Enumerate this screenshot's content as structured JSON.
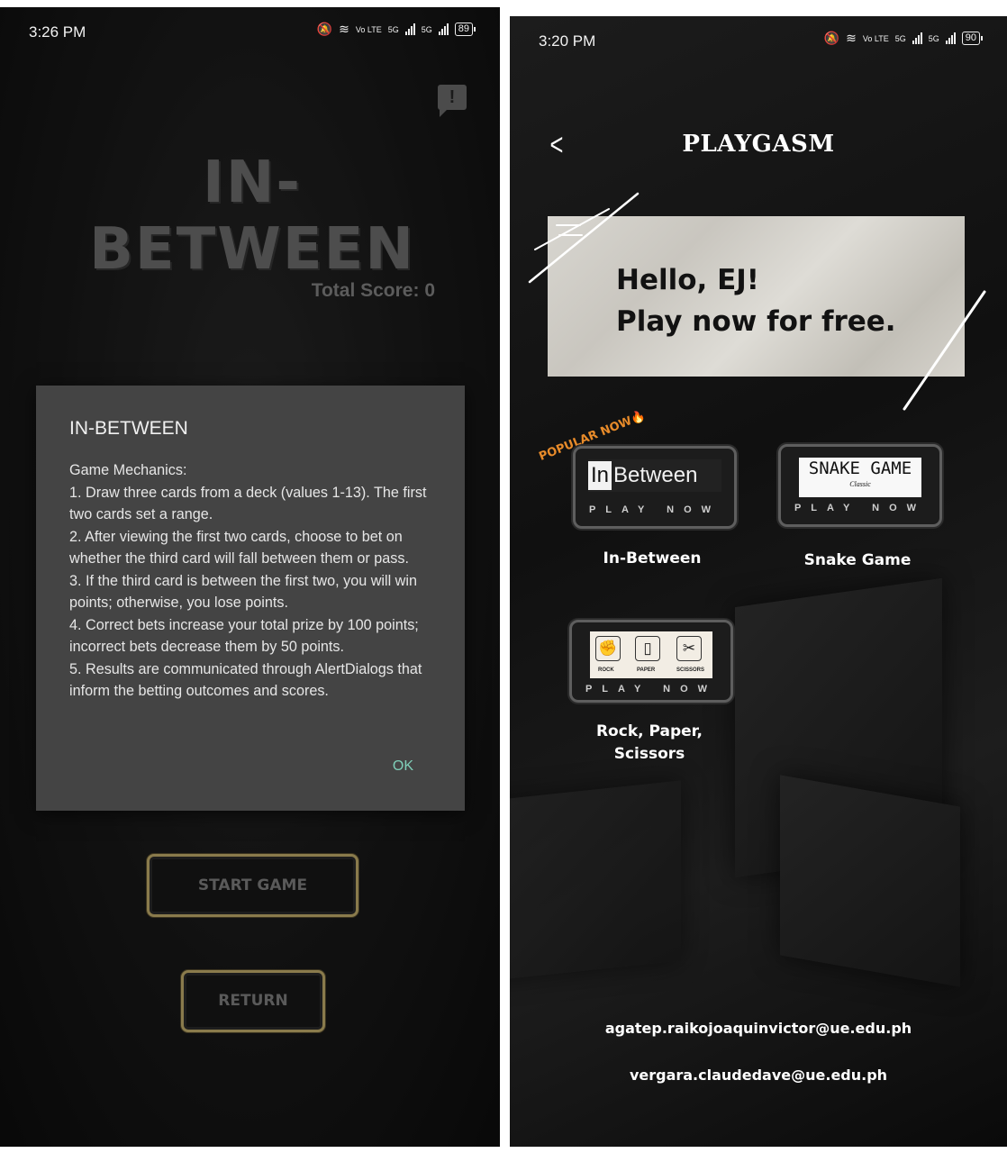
{
  "left_screen": {
    "status": {
      "time": "3:26 PM",
      "network_labels": [
        "Vo LTE",
        "5G",
        "5G"
      ],
      "battery": "89"
    },
    "game_title": "IN-BETWEEN",
    "total_score": "Total Score: 0",
    "dialog": {
      "title": "IN-BETWEEN",
      "heading": "Game Mechanics:",
      "rules": [
        "1. Draw three cards from a deck (values 1-13). The first two cards set a range.",
        "2. After viewing the first two cards, choose to bet on whether the third card will fall between them or pass.",
        "3. If the third card is between the first two, you will win points; otherwise, you lose points.",
        "4. Correct bets increase your total prize by 100 points; incorrect bets decrease them by 50 points.",
        "5. Results are communicated through AlertDialogs that inform the betting outcomes and scores."
      ],
      "ok_label": "OK"
    },
    "start_label": "START GAME",
    "return_label": "RETURN",
    "feedback_icon": "feedback-icon"
  },
  "right_screen": {
    "status": {
      "time": "3:20 PM",
      "network_labels": [
        "Vo LTE",
        "5G",
        "5G"
      ],
      "battery": "90"
    },
    "back_icon": "chevron-left-icon",
    "app_title": "PLAYGASM",
    "banner": {
      "line1": "Hello, EJ!",
      "line2": "Play now for free."
    },
    "popular_badge": "POPULAR NOW🔥",
    "games": [
      {
        "label": "In-Between",
        "logo_box": "In",
        "logo_rest": "Between",
        "play": "PLAY NOW"
      },
      {
        "label": "Snake Game",
        "logo_title": "SNAKE GAME",
        "logo_sub": "Classic",
        "play": "PLAY NOW"
      },
      {
        "label_line1": "Rock, Paper,",
        "label_line2": "Scissors",
        "words": [
          "ROCK",
          "PAPER",
          "SCISSORS"
        ],
        "play": "PLAY NOW"
      }
    ],
    "emails": [
      "agatep.raikojoaquinvictor@ue.edu.ph",
      "vergara.claudedave@ue.edu.ph"
    ]
  },
  "colors": {
    "dialog_bg": "#444444",
    "ok_accent": "#7fcfb8",
    "button_border": "#8a7b4c",
    "popular_accent": "#e88b2a"
  }
}
